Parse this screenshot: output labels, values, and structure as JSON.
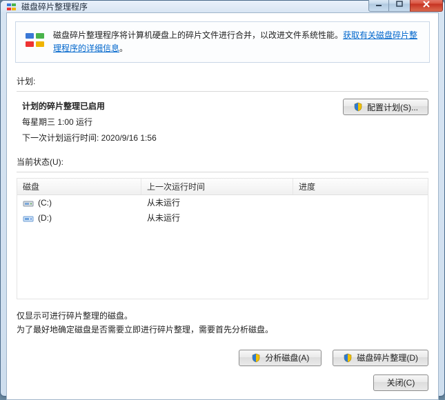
{
  "window": {
    "title": "磁盘碎片整理程序"
  },
  "banner": {
    "text_before_link": "磁盘碎片整理程序将计算机硬盘上的碎片文件进行合并，以改进文件系统性能。",
    "link_text": "获取有关磁盘碎片整理程序的详细信息",
    "after_link": "。"
  },
  "labels": {
    "schedule_section": "计划:",
    "status_section": "当前状态(U):"
  },
  "schedule": {
    "title": "计划的碎片整理已启用",
    "line1": "每星期三 1:00 运行",
    "line2": "下一次计划运行时间: 2020/9/16 1:56",
    "configure_button": "配置计划(S)..."
  },
  "table": {
    "headers": {
      "disk": "磁盘",
      "last_run": "上一次运行时间",
      "progress": "进度"
    },
    "rows": [
      {
        "icon": "drive-c",
        "name": "(C:)",
        "last_run": "从未运行",
        "progress": ""
      },
      {
        "icon": "drive-d",
        "name": "(D:)",
        "last_run": "从未运行",
        "progress": ""
      }
    ]
  },
  "footer_note": {
    "line1": "仅显示可进行碎片整理的磁盘。",
    "line2": "为了最好地确定磁盘是否需要立即进行碎片整理，需要首先分析磁盘。"
  },
  "buttons": {
    "analyze": "分析磁盘(A)",
    "defrag": "磁盘碎片整理(D)",
    "close": "关闭(C)"
  }
}
